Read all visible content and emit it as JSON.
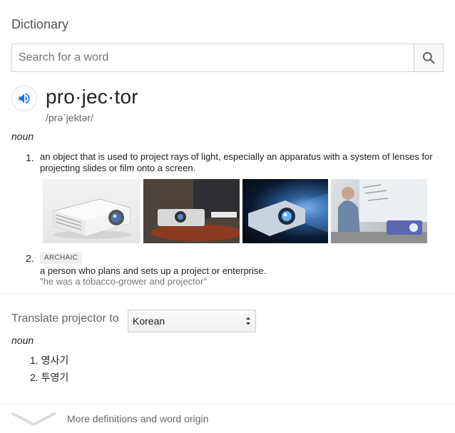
{
  "header": {
    "title": "Dictionary"
  },
  "search": {
    "placeholder": "Search for a word",
    "value": "",
    "icon": "search-icon"
  },
  "entry": {
    "word": "pro·jec·tor",
    "phonetic": "/prəˈjektər/",
    "audio_icon": "speaker-icon",
    "part_of_speech": "noun",
    "definitions": [
      {
        "number": "1.",
        "text": "an object that is used to project rays of light, especially an apparatus with a system of lenses for projecting slides or film onto a screen.",
        "images": [
          "projector-photo-1",
          "projector-photo-2",
          "projector-photo-3",
          "projector-photo-4"
        ]
      },
      {
        "number": "2.",
        "tag": "ARCHAIC",
        "text": "a person who plans and sets up a project or enterprise.",
        "example": "\"he was a tobacco-grower and projector\""
      }
    ]
  },
  "translate": {
    "label": "Translate projector to",
    "selected_language": "Korean",
    "part_of_speech": "noun",
    "items": [
      {
        "number": "1.",
        "text": "영사기"
      },
      {
        "number": "2.",
        "text": "투영기"
      }
    ]
  },
  "footer": {
    "more_label": "More definitions and word origin",
    "icon": "chevron-down-icon"
  },
  "colors": {
    "accent": "#1a73e8",
    "divider": "#ebebeb",
    "muted_text": "#666666"
  }
}
